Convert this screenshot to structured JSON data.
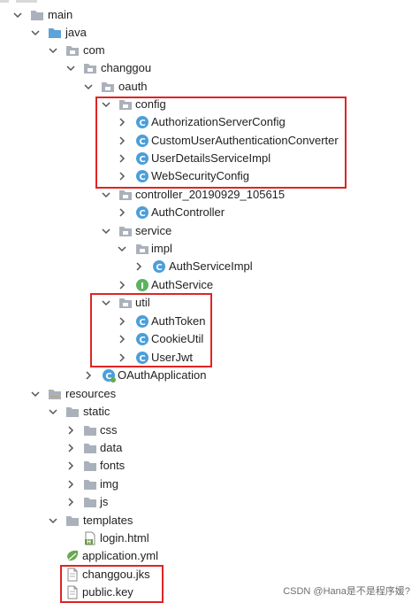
{
  "tree": {
    "main": "main",
    "java": "java",
    "com": "com",
    "changgou": "changgou",
    "oauth": "oauth",
    "config": "config",
    "authorization_server_config": "AuthorizationServerConfig",
    "custom_user_auth_converter": "CustomUserAuthenticationConverter",
    "user_details_service_impl": "UserDetailsServiceImpl",
    "web_security_config": "WebSecurityConfig",
    "controller": "controller_20190929_105615",
    "auth_controller": "AuthController",
    "service": "service",
    "impl": "impl",
    "auth_service_impl": "AuthServiceImpl",
    "auth_service": "AuthService",
    "util": "util",
    "auth_token": "AuthToken",
    "cookie_util": "CookieUtil",
    "user_jwt": "UserJwt",
    "oauth_application": "OAuthApplication",
    "resources": "resources",
    "static": "static",
    "css": "css",
    "data": "data",
    "fonts": "fonts",
    "img": "img",
    "js": "js",
    "templates": "templates",
    "login_html": "login.html",
    "application_yml": "application.yml",
    "changgou_jks": "changgou.jks",
    "public_key": "public.key"
  },
  "icon_badges": {
    "class": "C",
    "interface": "I",
    "html": "H"
  },
  "colors": {
    "folder": "#aab1ba",
    "source_folder": "#5ba3d9",
    "resources_folder": "#b9a88a",
    "class_fill": "#4b9fd9",
    "interface_fill": "#5bb362",
    "highlight": "#e02424"
  },
  "watermark": "CSDN @Hana是不是程序媛?"
}
